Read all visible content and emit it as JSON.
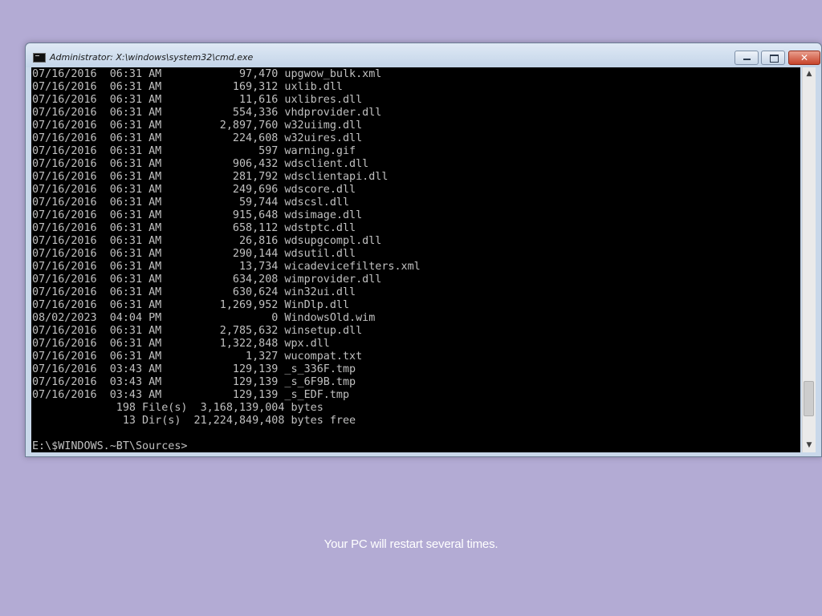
{
  "window": {
    "title": "Administrator: X:\\windows\\system32\\cmd.exe",
    "close_glyph": "✕"
  },
  "console": {
    "lines": [
      "07/16/2016  06:31 AM            97,470 upgwow_bulk.xml",
      "07/16/2016  06:31 AM           169,312 uxlib.dll",
      "07/16/2016  06:31 AM            11,616 uxlibres.dll",
      "07/16/2016  06:31 AM           554,336 vhdprovider.dll",
      "07/16/2016  06:31 AM         2,897,760 w32uiimg.dll",
      "07/16/2016  06:31 AM           224,608 w32uires.dll",
      "07/16/2016  06:31 AM               597 warning.gif",
      "07/16/2016  06:31 AM           906,432 wdsclient.dll",
      "07/16/2016  06:31 AM           281,792 wdsclientapi.dll",
      "07/16/2016  06:31 AM           249,696 wdscore.dll",
      "07/16/2016  06:31 AM            59,744 wdscsl.dll",
      "07/16/2016  06:31 AM           915,648 wdsimage.dll",
      "07/16/2016  06:31 AM           658,112 wdstptc.dll",
      "07/16/2016  06:31 AM            26,816 wdsupgcompl.dll",
      "07/16/2016  06:31 AM           290,144 wdsutil.dll",
      "07/16/2016  06:31 AM            13,734 wicadevicefilters.xml",
      "07/16/2016  06:31 AM           634,208 wimprovider.dll",
      "07/16/2016  06:31 AM           630,624 win32ui.dll",
      "07/16/2016  06:31 AM         1,269,952 WinDlp.dll",
      "08/02/2023  04:04 PM                 0 WindowsOld.wim",
      "07/16/2016  06:31 AM         2,785,632 winsetup.dll",
      "07/16/2016  06:31 AM         1,322,848 wpx.dll",
      "07/16/2016  06:31 AM             1,327 wucompat.txt",
      "07/16/2016  03:43 AM           129,139 _s_336F.tmp",
      "07/16/2016  03:43 AM           129,139 _s_6F9B.tmp",
      "07/16/2016  03:43 AM           129,139 _s_EDF.tmp",
      "             198 File(s)  3,168,139,004 bytes",
      "              13 Dir(s)  21,224,849,408 bytes free",
      "",
      "E:\\$WINDOWS.~BT\\Sources>"
    ],
    "text_color": "#c0c0c0",
    "background": "#000000"
  },
  "scrollbar": {
    "scroll_position": 0.93,
    "up_arrow": "▲",
    "down_arrow": "▼"
  },
  "setup": {
    "message": "Your PC will restart several times."
  },
  "colors": {
    "desktop_background": "#b3abd4",
    "title_bar": "#c9d8ea",
    "close_button": "#c7432a"
  }
}
